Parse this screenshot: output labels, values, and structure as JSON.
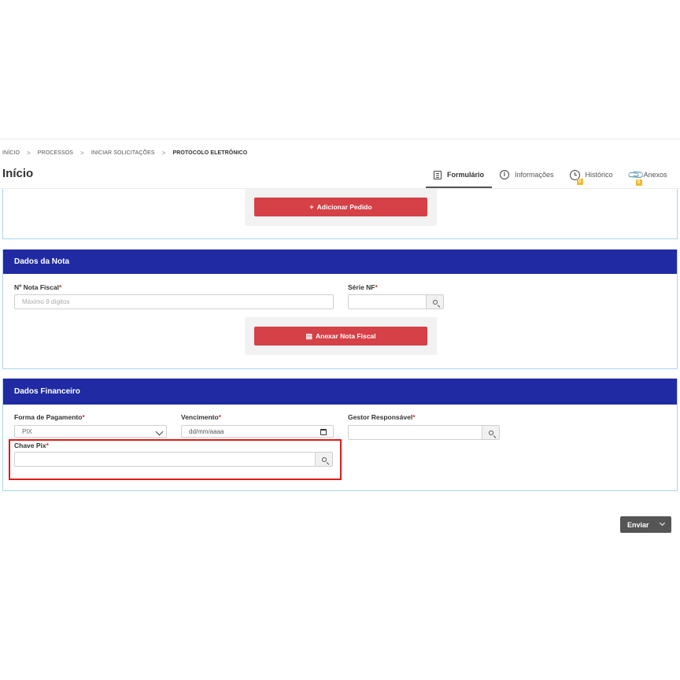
{
  "breadcrumb": {
    "items": [
      "INÍCIO",
      "PROCESSOS",
      "INICIAR SOLICITAÇÕES",
      "PROTOCOLO ELETRÔNICO"
    ],
    "separator": ">"
  },
  "page": {
    "title": "Início"
  },
  "tabs": [
    {
      "label": "Formulário",
      "icon": "document-icon",
      "active": true
    },
    {
      "label": "Informações",
      "icon": "info-icon",
      "active": false
    },
    {
      "label": "Histórico",
      "icon": "clock-icon",
      "badge": "0"
    },
    {
      "label": "Anexos",
      "icon": "paperclip-icon",
      "badge": "0"
    }
  ],
  "pedido": {
    "add_button_label": "Adicionar Pedido",
    "add_icon": "+"
  },
  "dados_nota": {
    "title": "Dados da Nota",
    "nota_fiscal": {
      "label": "Nº Nota Fiscal",
      "required_mark": "*",
      "placeholder": "Máximo 9 dígitos",
      "value": ""
    },
    "serie_nf": {
      "label": "Série NF",
      "required_mark": "*",
      "value": ""
    },
    "attach_button_label": "Anexar Nota Fiscal",
    "attach_icon": "file-icon"
  },
  "dados_financeiro": {
    "title": "Dados Financeiro",
    "forma_pagamento": {
      "label": "Forma de Pagamento",
      "required_mark": "*",
      "value": "PIX"
    },
    "vencimento": {
      "label": "Vencimento",
      "required_mark": "*",
      "value": "dd/mm/aaaa"
    },
    "gestor": {
      "label": "Gestor Responsável",
      "required_mark": "*",
      "value": ""
    },
    "chave_pix": {
      "label": "Chave Pix",
      "required_mark": "*",
      "value": ""
    }
  },
  "footer": {
    "send_label": "Enviar"
  },
  "colors": {
    "header_blue": "#1f2aa3",
    "button_red": "#d64047",
    "highlight_red": "#e11b1b",
    "badge_yellow": "#f3b82b"
  }
}
